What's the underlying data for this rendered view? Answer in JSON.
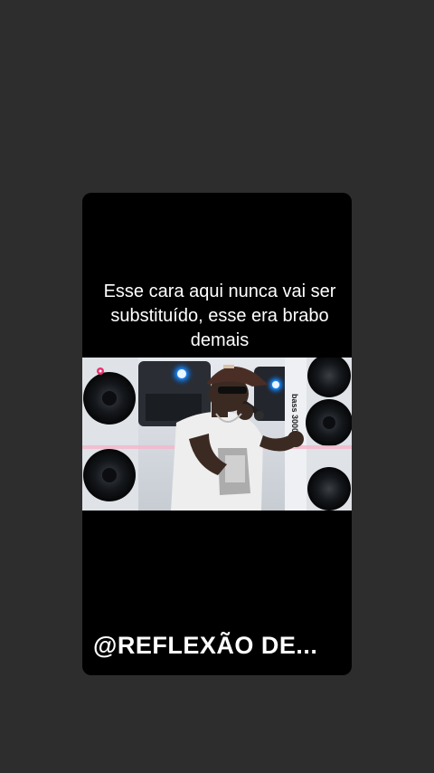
{
  "story": {
    "caption_line1": "Esse cara aqui nunca vai ser",
    "caption_line2": "substituído, esse era brabo",
    "caption_line3": "demais",
    "watermark": "@REFLEXÃO DE...",
    "video": {
      "speaker_brand_label": "bass 3000",
      "live_badge_icon": "record-dot-icon"
    }
  },
  "colors": {
    "background": "#2e2d2e",
    "card": "#000000",
    "text": "#ffffff",
    "stage_light": "#1e8bff"
  }
}
